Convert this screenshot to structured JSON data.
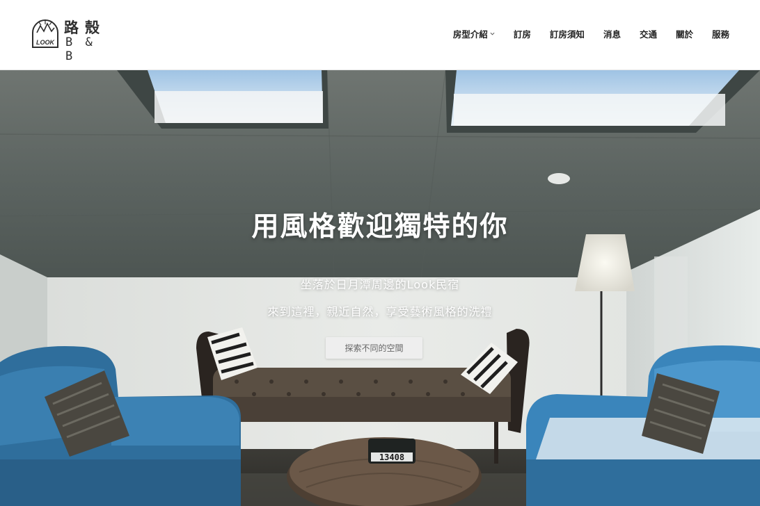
{
  "logo": {
    "mark_text": "LOOK",
    "name_cn": "路殼",
    "name_en": "B & B"
  },
  "nav": {
    "items": [
      {
        "label": "房型介紹",
        "has_dropdown": true
      },
      {
        "label": "訂房"
      },
      {
        "label": "訂房須知"
      },
      {
        "label": "消息"
      },
      {
        "label": "交通"
      },
      {
        "label": "關於"
      },
      {
        "label": "服務"
      }
    ]
  },
  "hero": {
    "title": "用風格歡迎獨特的你",
    "subtitle_1": "坐落於日月潭周邊的Look民宿",
    "subtitle_2": "來到這裡，親近自然，享受藝術風格的洗禮",
    "cta_label": "探索不同的空間",
    "table_number": "13408"
  },
  "colors": {
    "header_bg": "#ffffff",
    "nav_text": "#222222",
    "hero_text": "#ffffff",
    "cta_bg": "#eeeeee",
    "sofa_blue": "#2f6e9c"
  }
}
